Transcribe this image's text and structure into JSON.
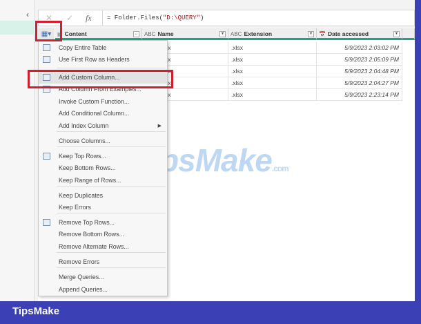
{
  "formula_bar": {
    "cancel": "✕",
    "confirm": "✓",
    "fx": "fx",
    "formula_prefix": "= Folder.Files(",
    "formula_arg": "\"D:\\QUERY\"",
    "formula_suffix": ")"
  },
  "columns": [
    {
      "type_icon": "▤",
      "label": "Content"
    },
    {
      "type_icon": "ABC",
      "label": "Name"
    },
    {
      "type_icon": "ABC",
      "label": "Extension"
    },
    {
      "type_icon": "📅",
      "label": "Date accessed"
    }
  ],
  "rows": [
    {
      "name": "sx",
      "extension": ".xlsx",
      "date": "5/9/2023 2:03:02 PM"
    },
    {
      "name": "sx",
      "extension": ".xlsx",
      "date": "5/9/2023 2:05:09 PM"
    },
    {
      "name": "sx",
      "extension": ".xlsx",
      "date": "5/9/2023 2:04:48 PM"
    },
    {
      "name": "sx",
      "extension": ".xlsx",
      "date": "5/9/2023 2:04:27 PM"
    },
    {
      "name": "sx",
      "extension": ".xlsx",
      "date": "5/9/2023 2:23:14 PM"
    }
  ],
  "menu": [
    "Copy Entire Table",
    "Use First Row as Headers",
    "Add Custom Column...",
    "Add Column From Examples...",
    "Invoke Custom Function...",
    "Add Conditional Column...",
    "Add Index Column",
    "Choose Columns...",
    "Keep Top Rows...",
    "Keep Bottom Rows...",
    "Keep Range of Rows...",
    "Keep Duplicates",
    "Keep Errors",
    "Remove Top Rows...",
    "Remove Bottom Rows...",
    "Remove Alternate Rows...",
    "Remove Errors",
    "Merge Queries...",
    "Append Queries..."
  ],
  "watermark": {
    "main": "TipsMake",
    "suffix": ".com"
  },
  "footer_brand": "TipsMake",
  "colors": {
    "frame": "#3b40b5",
    "accent": "#1fa383",
    "highlight": "#d02030"
  }
}
